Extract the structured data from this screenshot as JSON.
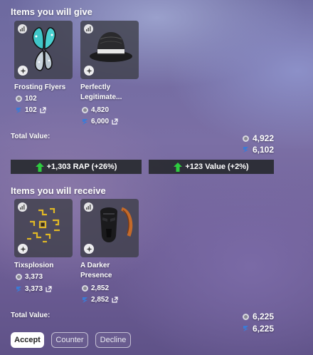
{
  "give": {
    "title": "Items you will give",
    "items": [
      {
        "name_line1": "Frosting Flyers",
        "name_line2": "",
        "rap": "102",
        "value": "102"
      },
      {
        "name_line1": "Perfectly",
        "name_line2": "Legitimate...",
        "rap": "4,820",
        "value": "6,000"
      }
    ],
    "total_label": "Total Value:",
    "total_rap": "4,922",
    "total_value": "6,102"
  },
  "summary": {
    "rap_change": "+1,303 RAP (+26%)",
    "value_change": "+123 Value (+2%)"
  },
  "receive": {
    "title": "Items you will receive",
    "items": [
      {
        "name_line1": "Tixsplosion",
        "name_line2": "",
        "rap": "3,373",
        "value": "3,373"
      },
      {
        "name_line1": "A Darker",
        "name_line2": "Presence",
        "rap": "2,852",
        "value": "2,852"
      }
    ],
    "total_label": "Total Value:",
    "total_rap": "6,225",
    "total_value": "6,225"
  },
  "actions": {
    "accept": "Accept",
    "counter": "Counter",
    "decline": "Decline"
  },
  "colors": {
    "up_arrow": "#2ecc40",
    "value_icon": "#3b7bd6"
  },
  "icons": [
    "chart-icon",
    "limited-icon",
    "rap-icon",
    "value-icon",
    "external-link-icon",
    "up-arrow-icon"
  ]
}
